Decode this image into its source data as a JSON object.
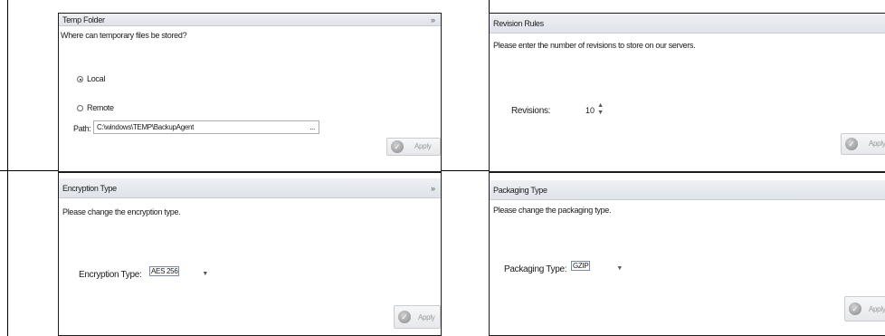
{
  "temp_folder": {
    "title": "Temp Folder",
    "collapse_glyph": "»",
    "question": "Where can temporary files be stored?",
    "options": [
      {
        "label": "Local",
        "selected": true
      },
      {
        "label": "Remote",
        "selected": false
      }
    ],
    "path_label": "Path:",
    "path_value": "C:\\windows\\TEMP\\BackupAgent",
    "browse_label": "...",
    "apply_label": "Apply"
  },
  "revision_rules": {
    "title": "Revision Rules",
    "description": "Please enter the number of revisions to store on our servers.",
    "revisions_label": "Revisions:",
    "revisions_value": "10",
    "apply_label": "Apply"
  },
  "encryption": {
    "title": "Encryption Type",
    "collapse_glyph": "»",
    "description": "Please change the encryption type.",
    "field_label": "Encryption Type:",
    "selected_value": "AES 256",
    "apply_label": "Apply"
  },
  "packaging": {
    "title": "Packaging Type",
    "description": "Please change the packaging type.",
    "field_label": "Packaging Type:",
    "selected_value": "GZIP",
    "apply_label": "Apply"
  },
  "icons": {
    "apply": "check-circle-icon",
    "dropdown": "chevron-down-icon",
    "spinner": "up-down-spinner-icon"
  }
}
